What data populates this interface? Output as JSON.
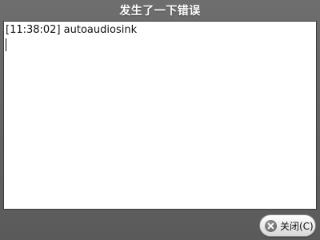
{
  "dialog": {
    "title": "发生了一下错误",
    "log_text": "[11:38:02] autoaudiosink",
    "close_button": {
      "label": "关闭(C)",
      "icon": "close-icon"
    }
  }
}
